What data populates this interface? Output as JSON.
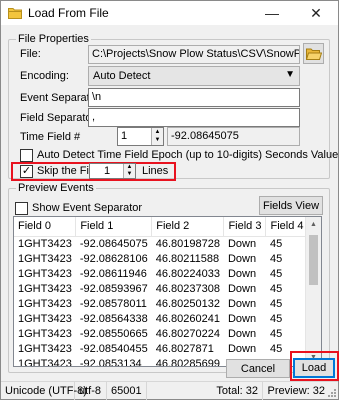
{
  "window": {
    "title": "Load From File",
    "app_icon": "folder-icon",
    "minimize_glyph": "—",
    "close_glyph": "✕"
  },
  "file_properties": {
    "legend": "File Properties",
    "file_label": "File:",
    "file_value": "C:\\Projects\\Snow Plow Status\\CSV\\SnowPlowAVL.csv",
    "browse_icon": "folder-open-icon",
    "encoding_label": "Encoding:",
    "encoding_value": "Auto Detect",
    "event_sep_label": "Event Separator:",
    "event_sep_value": "\\n",
    "field_sep_label": "Field Separator:",
    "field_sep_value": ",",
    "time_field_label": "Time Field #",
    "time_field_value": "1",
    "time_field_preview": "-92.08645075",
    "auto_detect_label": "Auto Detect Time Field Epoch (up to 10-digits) Seconds Value",
    "auto_detect_checked": false,
    "skip_label": "Skip the First",
    "skip_value": "1",
    "skip_suffix": "Lines",
    "skip_checked": true
  },
  "preview": {
    "legend": "Preview Events",
    "show_separator_label": "Show Event Separator",
    "show_separator_checked": false,
    "fields_view_label": "Fields View",
    "columns": [
      "Field 0",
      "Field 1",
      "Field 2",
      "Field 3",
      "Field 4"
    ],
    "rows": [
      [
        "1GHT3423",
        "-92.08645075",
        "46.80198728",
        "Down",
        "45"
      ],
      [
        "1GHT3423",
        "-92.08628106",
        "46.80211588",
        "Down",
        "45"
      ],
      [
        "1GHT3423",
        "-92.08611946",
        "46.80224033",
        "Down",
        "45"
      ],
      [
        "1GHT3423",
        "-92.08593967",
        "46.80237308",
        "Down",
        "45"
      ],
      [
        "1GHT3423",
        "-92.08578011",
        "46.80250132",
        "Down",
        "45"
      ],
      [
        "1GHT3423",
        "-92.08564338",
        "46.80260241",
        "Down",
        "45"
      ],
      [
        "1GHT3423",
        "-92.08550665",
        "46.80270224",
        "Down",
        "45"
      ],
      [
        "1GHT3423",
        "-92.08540455",
        "46.8027871",
        "Down",
        "45"
      ],
      [
        "1GHT3423",
        "-92.0853134",
        "46.80285699",
        "Down",
        "45"
      ]
    ]
  },
  "buttons": {
    "cancel": "Cancel",
    "load": "Load"
  },
  "status": {
    "encoding": "Unicode (UTF-8)",
    "charset": "utf-8",
    "codepage": "65001",
    "total": "Total: 32",
    "preview": "Preview: 32"
  },
  "colors": {
    "highlight": "#e8121f",
    "default_button_border": "#0078d7"
  }
}
